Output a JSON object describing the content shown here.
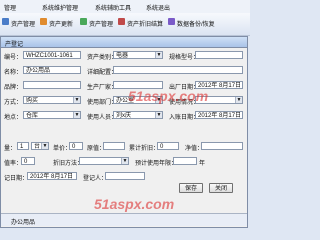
{
  "menubar": {
    "items": [
      "管理",
      "系统维护管理",
      "系统辅助工具",
      "系统退出"
    ]
  },
  "toolbar": {
    "items": [
      "资产管理",
      "资产更新",
      "资产管理",
      "资产折旧结算",
      "数据备份/恢复"
    ]
  },
  "dialog": {
    "title": "产登记",
    "asset_no_label": "编号：",
    "asset_no": "WHZC1001-1061",
    "category_label": "资产类别：",
    "category": "电器",
    "spec_label": "规格型号：",
    "spec": "",
    "name_label": "名称：",
    "name": "办公用品",
    "detail_label": "详细配置：",
    "detail": "",
    "brand_label": "品牌：",
    "brand": "",
    "manufacturer_label": "生产厂家：",
    "manufacturer": "",
    "factory_date_label": "出厂日期：",
    "factory_date": "2012年 8月17日",
    "acquire_label": "方式：",
    "acquire": "购买",
    "dept_label": "使用部门：",
    "dept": "办公室",
    "status_label": "使用情况：",
    "status": "",
    "location_label": "地点：",
    "location": "仓库",
    "user_label": "使用人员：",
    "user": "刘x庆",
    "entry_date_label": "入账日期：",
    "entry_date": "2012年 8月17日",
    "qty_label": "量：",
    "qty": "1",
    "qty_unit": "台",
    "price_label": "单价：",
    "price": "0",
    "original_label": "原值：",
    "original": "",
    "total_depr_label": "累计折旧：",
    "total_depr": "0",
    "net_label": "净值：",
    "net": "",
    "rate_label": "值率：",
    "rate": "0",
    "method_label": "折旧方法：",
    "method": "",
    "life_label": "预计使用年限：",
    "life": "",
    "years_unit": "年",
    "record_date_label": "记日期：",
    "record_date": "2012年 8月17日",
    "recorder_label": "登记人：",
    "recorder": "",
    "save_label": "保存",
    "close_label": "关闭",
    "footer_text": "办公用品"
  },
  "watermark": {
    "line1": "51aspx.com",
    "line2": "51aspx.com"
  }
}
